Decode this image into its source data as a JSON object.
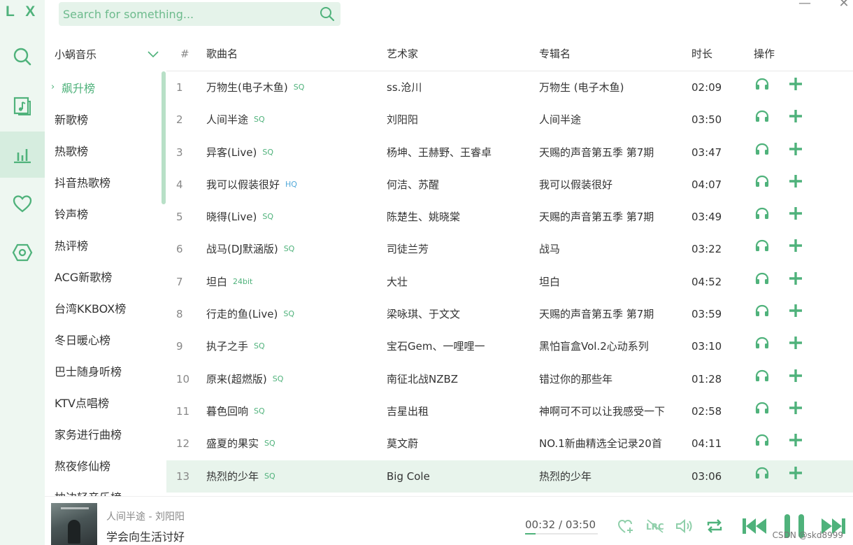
{
  "app": {
    "logo": "L X"
  },
  "search": {
    "placeholder": "Search for something..."
  },
  "window": {
    "minimize": "—",
    "close": "✕"
  },
  "source": {
    "selected": "小蜗音乐"
  },
  "boards": [
    {
      "label": "飙升榜",
      "active": true
    },
    {
      "label": "新歌榜"
    },
    {
      "label": "热歌榜"
    },
    {
      "label": "抖音热歌榜"
    },
    {
      "label": "铃声榜"
    },
    {
      "label": "热评榜"
    },
    {
      "label": "ACG新歌榜"
    },
    {
      "label": "台湾KKBOX榜"
    },
    {
      "label": "冬日暖心榜"
    },
    {
      "label": "巴士随身听榜"
    },
    {
      "label": "KTV点唱榜"
    },
    {
      "label": "家务进行曲榜"
    },
    {
      "label": "熬夜修仙榜"
    },
    {
      "label": "枕边轻音乐榜"
    }
  ],
  "table": {
    "headers": {
      "num": "#",
      "name": "歌曲名",
      "artist": "艺术家",
      "album": "专辑名",
      "duration": "时长",
      "ops": "操作"
    },
    "rows": [
      {
        "num": "1",
        "name": "万物生(电子木鱼)",
        "tag": "SQ",
        "artist": "ss.沧川",
        "album": "万物生 (电子木鱼)",
        "duration": "02:09"
      },
      {
        "num": "2",
        "name": "人间半途",
        "tag": "SQ",
        "artist": "刘阳阳",
        "album": "人间半途",
        "duration": "03:50"
      },
      {
        "num": "3",
        "name": "异客(Live)",
        "tag": "SQ",
        "artist": "杨坤、王赫野、王睿卓",
        "album": "天赐的声音第五季 第7期",
        "duration": "03:47"
      },
      {
        "num": "4",
        "name": "我可以假装很好",
        "tag": "HQ",
        "artist": "何洁、苏醒",
        "album": "我可以假装很好",
        "duration": "04:07"
      },
      {
        "num": "5",
        "name": "晓得(Live)",
        "tag": "SQ",
        "artist": "陈楚生、姚晓棠",
        "album": "天赐的声音第五季 第7期",
        "duration": "03:49"
      },
      {
        "num": "6",
        "name": "战马(DJ默涵版)",
        "tag": "SQ",
        "artist": "司徒兰芳",
        "album": "战马",
        "duration": "03:22"
      },
      {
        "num": "7",
        "name": "坦白",
        "tag": "24bit",
        "artist": "大壮",
        "album": "坦白",
        "duration": "04:52"
      },
      {
        "num": "8",
        "name": "行走的鱼(Live)",
        "tag": "SQ",
        "artist": "梁咏琪、于文文",
        "album": "天赐的声音第五季 第7期",
        "duration": "03:59"
      },
      {
        "num": "9",
        "name": "执子之手",
        "tag": "SQ",
        "artist": "宝石Gem、一哩哩一",
        "album": "黑怕盲盒Vol.2心动系列",
        "duration": "03:10"
      },
      {
        "num": "10",
        "name": "原来(超燃版)",
        "tag": "SQ",
        "artist": "南征北战NZBZ",
        "album": "错过你的那些年",
        "duration": "01:28"
      },
      {
        "num": "11",
        "name": "暮色回响",
        "tag": "SQ",
        "artist": "吉星出租",
        "album": "神啊可不可以让我感受一下",
        "duration": "02:58"
      },
      {
        "num": "12",
        "name": "盛夏的果实",
        "tag": "SQ",
        "artist": "莫文蔚",
        "album": "NO.1新曲精选全记录20首",
        "duration": "04:11"
      },
      {
        "num": "13",
        "name": "热烈的少年",
        "tag": "SQ",
        "artist": "Big Cole",
        "album": "热烈的少年",
        "duration": "03:06",
        "highlight": true
      }
    ]
  },
  "player": {
    "song": "人间半途 - 刘阳阳",
    "lyric": "学会向生活讨好",
    "time": "00:32 / 03:50",
    "progress": 0.14
  },
  "watermark": "CSDN @skd8999",
  "colors": {
    "accent": "#4fb27b",
    "rail_bg": "#eef7f1",
    "search_bg": "#e5f3ea",
    "hq": "#52a9d9"
  },
  "icons": [
    "search-icon",
    "music-file-icon",
    "chart-bars-icon",
    "heart-icon",
    "hexagon-settings-icon",
    "chevron-down-icon",
    "headphones-icon",
    "plus-icon",
    "heart-add-icon",
    "lyrics-icon",
    "volume-icon",
    "repeat-icon",
    "previous-icon",
    "pause-icon",
    "next-icon"
  ]
}
